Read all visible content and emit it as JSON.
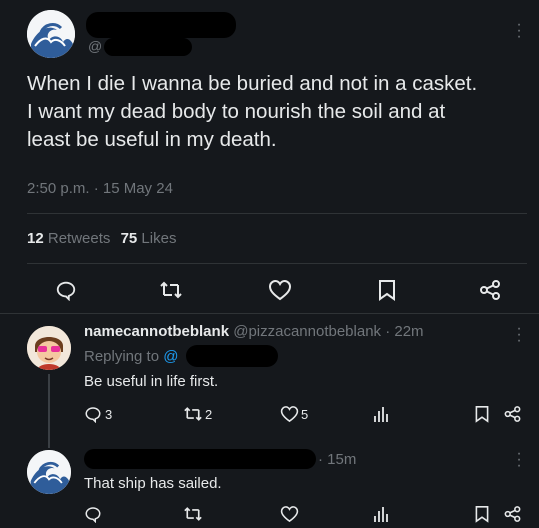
{
  "main_tweet": {
    "handle_prefix": "@",
    "text_lines": [
      "When I die I wanna be buried and not in a casket.",
      "I want my dead body to nourish the soil and at",
      "least be useful in my death."
    ],
    "timestamp": "2:50 p.m. · 15 May 24",
    "retweets_count": "12",
    "retweets_label": "Retweets",
    "likes_count": "75",
    "likes_label": "Likes"
  },
  "reply1": {
    "display_name": "namecannotbeblank",
    "handle_time": "@pizzacannotbeblank · 22m",
    "replying_to_label": "Replying to",
    "replying_to_handle": "@",
    "text": "Be useful in life first.",
    "reply_count": "3",
    "retweet_count": "2",
    "like_count": "5"
  },
  "reply2": {
    "time": "· 15m",
    "text": "That ship has sailed."
  },
  "icons": {
    "reply": "reply-icon",
    "retweet": "retweet-icon",
    "like": "heart-icon",
    "bookmark": "bookmark-icon",
    "share": "share-icon",
    "views": "views-icon",
    "more": "more-icon"
  },
  "colors": {
    "background": "#15181c",
    "text": "#e7e9ea",
    "muted": "#71767b",
    "accent": "#1d9bf0"
  }
}
